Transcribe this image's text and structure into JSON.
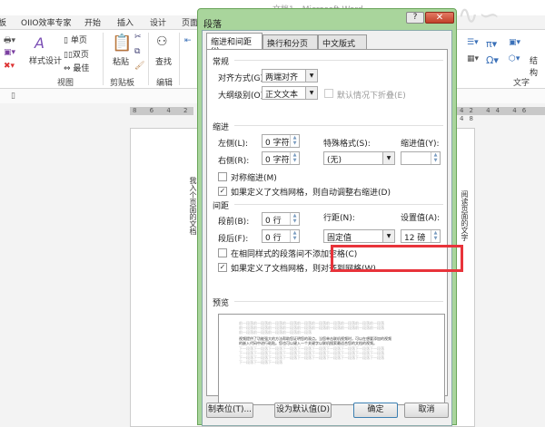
{
  "window": {
    "title": "文档1 - Microsoft Word"
  },
  "ribbon": {
    "tabs": [
      "板",
      "OIIO效率专家",
      "开始",
      "插入",
      "设计",
      "页面"
    ],
    "view_group": {
      "label": "视图",
      "items": [
        "样式设计",
        "单页",
        "双页",
        "最佳"
      ]
    },
    "clipboard_group": {
      "label": "剪贴板",
      "items": [
        "粘贴"
      ]
    },
    "edit_group": {
      "label": "编辑",
      "items": [
        "查找"
      ]
    },
    "text_group": {
      "label": "文字",
      "items": [
        "结构"
      ]
    }
  },
  "rulers": {
    "left": "8 6 4 2",
    "right": "42 44 46 48"
  },
  "document": {
    "vertical_text_left": "我入个页面的文档",
    "vertical_text_right": "阅读页面的文字"
  },
  "dialog": {
    "title": "段落",
    "help": "?",
    "close": "✕",
    "tabs": [
      "缩进和间距(I)",
      "换行和分页(P)",
      "中文版式(H)"
    ],
    "general": {
      "heading": "常规",
      "alignment_label": "对齐方式(G):",
      "alignment_value": "两端对齐",
      "outline_label": "大纲级别(O):",
      "outline_value": "正文文本",
      "collapse_label": "默认情况下折叠(E)",
      "collapse_checked": false
    },
    "indent": {
      "heading": "缩进",
      "left_label": "左侧(L):",
      "left_value": "0 字符",
      "right_label": "右侧(R):",
      "right_value": "0 字符",
      "special_label": "特殊格式(S):",
      "special_value": "(无)",
      "by_label": "缩进值(Y):",
      "by_value": "",
      "mirror_label": "对称缩进(M)",
      "mirror_checked": false,
      "auto_adjust_label": "如果定义了文档网格，则自动调整右缩进(D)",
      "auto_adjust_checked": true
    },
    "spacing": {
      "heading": "间距",
      "before_label": "段前(B):",
      "before_value": "0 行",
      "after_label": "段后(F):",
      "after_value": "0 行",
      "line_label": "行距(N):",
      "line_value": "固定值",
      "at_label": "设置值(A):",
      "at_value": "12 磅",
      "no_space_label": "在相同样式的段落间不添加空格(C)",
      "no_space_checked": false,
      "snap_label": "如果定义了文档网格，则对齐到网格(W)",
      "snap_checked": true
    },
    "preview": {
      "heading": "预览",
      "prev_lines": [
        "前一段落前一段落前一段落前一段落前一段落前一段落前一段落前一段落前一段落前一段落",
        "前一段落前一段落前一段落前一段落前一段落前一段落前一段落前一段落前一段落前一段落",
        "前一段落前一段落前一段落前一段落前一段落"
      ],
      "sample_lines": [
        "视频提供了功能强大的方法帮助您证明您的观点。当您单击联机视频时，可以在想要添加的视频",
        "的嵌入代码中进行粘贴。您也可以键入一个关键字以联机搜索最适合您的文档的视频。"
      ],
      "next_lines": [
        "下一段落下一段落下一段落下一段落下一段落下一段落下一段落下一段落下一段落下一段落",
        "下一段落下一段落下一段落下一段落下一段落下一段落下一段落下一段落下一段落下一段落",
        "下一段落下一段落下一段落下一段落下一段落下一段落下一段落下一段落下一段落下一段落",
        "下一段落下一段落下一段落"
      ]
    },
    "buttons": {
      "tabs": "制表位(T)...",
      "set_default": "设为默认值(D)",
      "ok": "确定",
      "cancel": "取消"
    }
  },
  "colors": {
    "highlight": "#e8333a",
    "dialog_frame": "#a9d59c",
    "close_button": "#c2412a"
  }
}
